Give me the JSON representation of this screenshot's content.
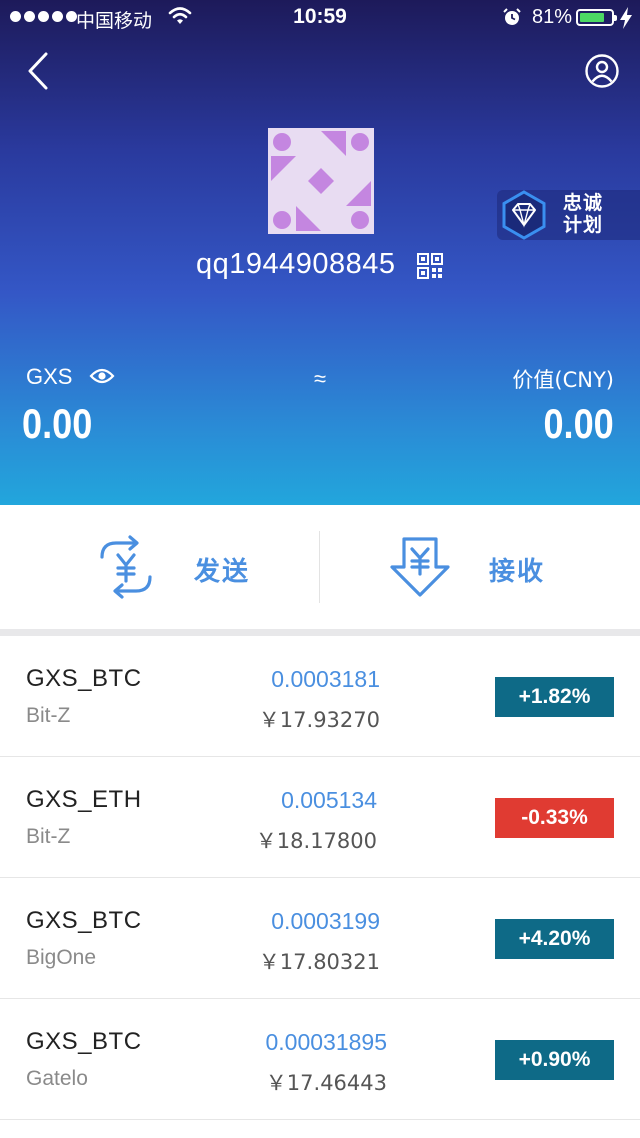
{
  "status_bar": {
    "carrier": "中国移动",
    "time": "10:59",
    "battery_percent": "81%",
    "battery_level": 0.81,
    "battery_color": "#4cd964"
  },
  "nav": {
    "back_icon": "chevron-left-icon",
    "profile_icon": "user-circle-icon"
  },
  "account": {
    "name": "qq1944908845",
    "qr_icon": "qr-code-icon"
  },
  "loyalty_badge": {
    "label": "忠诚计划",
    "icon": "diamond-icon"
  },
  "balance": {
    "token_label": "GXS",
    "token_value": "0.00",
    "approx_symbol": "≈",
    "value_label": "价值(CNY)",
    "value_amount": "0.00"
  },
  "actions": {
    "send_label": "发送",
    "receive_label": "接收"
  },
  "colors": {
    "positive": "#0e6a87",
    "negative": "#e03b32",
    "accent": "#4a8fe0"
  },
  "markets": [
    {
      "pair": "GXS_BTC",
      "exchange": "Bit-Z",
      "price": "0.0003181",
      "cny": "￥17.93270",
      "change": "+1.82%",
      "direction": "up"
    },
    {
      "pair": "GXS_ETH",
      "exchange": "Bit-Z",
      "price": "0.005134",
      "cny": "￥18.17800",
      "change": "-0.33%",
      "direction": "down"
    },
    {
      "pair": "GXS_BTC",
      "exchange": "BigOne",
      "price": "0.0003199",
      "cny": "￥17.80321",
      "change": "+4.20%",
      "direction": "up"
    },
    {
      "pair": "GXS_BTC",
      "exchange": "Gatelo",
      "price": "0.00031895",
      "cny": "￥17.46443",
      "change": "+0.90%",
      "direction": "up"
    }
  ]
}
